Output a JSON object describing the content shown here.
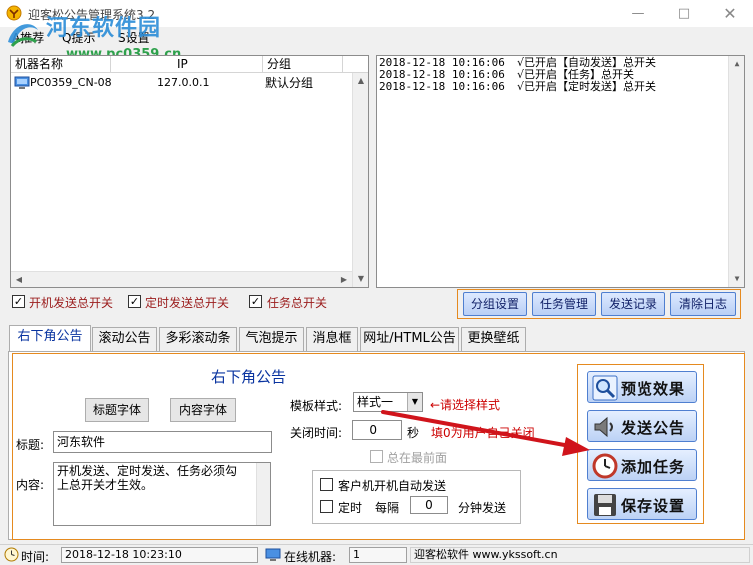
{
  "window": {
    "title": "迎客松公告管理系统3.2",
    "minimize_icon": "minimize-icon",
    "maximize_icon": "maximize-icon",
    "close_icon": "close-icon"
  },
  "watermark": {
    "text": "河东软件园",
    "url": "www.pc0359.cn"
  },
  "menu": {
    "items": [
      "A推荐",
      "Q提示",
      "S设置"
    ]
  },
  "machine_list": {
    "columns": [
      "机器名称",
      "IP",
      "分组"
    ],
    "rows": [
      {
        "name": "PC0359_CN-08",
        "ip": "127.0.0.1",
        "group": "默认分组"
      }
    ]
  },
  "log": {
    "lines": [
      {
        "time": "2018-12-18 10:16:06",
        "msg": "√已开启【自动发送】总开关"
      },
      {
        "time": "2018-12-18 10:16:06",
        "msg": "√已开启【任务】总开关"
      },
      {
        "time": "2018-12-18 10:16:06",
        "msg": "√已开启【定时发送】总开关"
      }
    ]
  },
  "switches": [
    {
      "label": "开机发送总开关",
      "checked": true
    },
    {
      "label": "定时发送总开关",
      "checked": true
    },
    {
      "label": "任务总开关",
      "checked": true
    }
  ],
  "group_buttons": [
    "分组设置",
    "任务管理",
    "发送记录",
    "清除日志"
  ],
  "tabs": [
    "右下角公告",
    "滚动公告",
    "多彩滚动条",
    "气泡提示",
    "消息框",
    "网址/HTML公告",
    "更换壁纸"
  ],
  "panel": {
    "title": "右下角公告",
    "title_font_button": "标题字体",
    "content_font_button": "内容字体",
    "title_label": "标题:",
    "title_value": "河东软件",
    "content_label": "内容:",
    "content_value": "开机发送、定时发送、任务必须勾上总开关才生效。",
    "style_label": "模板样式:",
    "style_value": "样式一",
    "style_note": "←请选择样式",
    "close_label": "关闭时间:",
    "close_value": "0",
    "close_unit": "秒",
    "close_note": "填0为用户自己关闭",
    "topmost_label": "总在最前面",
    "auto_send_label": "客户机开机自动发送",
    "timed_label": "定时",
    "every_label": "每隔",
    "interval_value": "0",
    "interval_unit": "分钟发送"
  },
  "actions": [
    "预览效果",
    "发送公告",
    "添加任务",
    "保存设置"
  ],
  "status": {
    "time_label": "时间:",
    "time_value": "2018-12-18 10:23:10",
    "online_label": "在线机器:",
    "online_value": "1",
    "brand": "迎客松软件 www.ykssoft.cn"
  },
  "colors": {
    "accent_orange": "#e58a1f",
    "title_blue": "#0a34a0",
    "switch_red": "#9b1c1c",
    "arrow_red": "#d0141b"
  }
}
